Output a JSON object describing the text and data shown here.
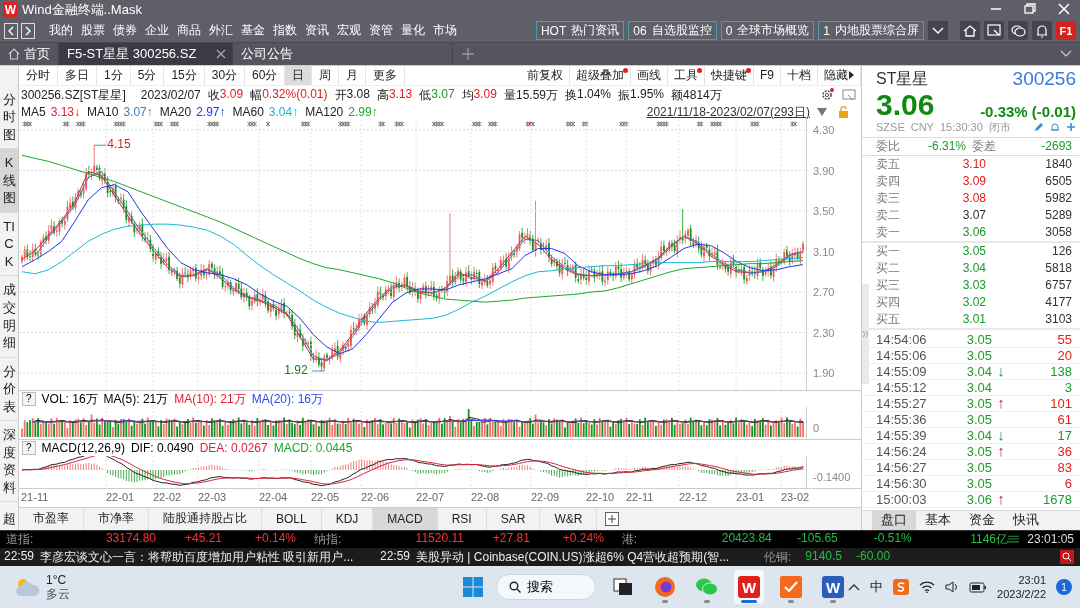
{
  "window": {
    "logo": "W",
    "title": "Wind金融终端..Mask"
  },
  "menu": [
    "我的",
    "股票",
    "债券",
    "企业",
    "商品",
    "外汇",
    "基金",
    "指数",
    "资讯",
    "宏观",
    "资管",
    "量化",
    "市场"
  ],
  "quick_links": [
    {
      "code": "HOT",
      "label": "热门资讯"
    },
    {
      "code": "06",
      "label": "自选股监控"
    },
    {
      "code": "0",
      "label": "全球市场概览"
    },
    {
      "code": "1",
      "label": "内地股票综合屏"
    }
  ],
  "help_badge": "F1",
  "tabs": [
    {
      "label": "首页",
      "kind": "home",
      "selected": false
    },
    {
      "label": "F5-ST星星 300256.SZ",
      "kind": "page",
      "selected": true
    },
    {
      "label": "公司公告",
      "kind": "page",
      "selected": false
    }
  ],
  "side_tabs": [
    {
      "label": "分时图",
      "selected": false
    },
    {
      "label": "K线图",
      "selected": true
    },
    {
      "label": "TICK",
      "selected": false
    },
    {
      "label": "成交明细",
      "selected": false
    },
    {
      "label": "分价表",
      "selected": false
    },
    {
      "label": "深度资料",
      "selected": false
    },
    {
      "label": "超",
      "selected": false
    }
  ],
  "periods": [
    {
      "label": "分时",
      "selected": false
    },
    {
      "label": "多日",
      "selected": false
    },
    {
      "label": "1分",
      "selected": false
    },
    {
      "label": "5分",
      "selected": false
    },
    {
      "label": "15分",
      "selected": false
    },
    {
      "label": "30分",
      "selected": false
    },
    {
      "label": "60分",
      "selected": false
    },
    {
      "label": "日",
      "selected": true
    },
    {
      "label": "周",
      "selected": false
    },
    {
      "label": "月",
      "selected": false
    },
    {
      "label": "更多",
      "selected": false
    }
  ],
  "tools": [
    {
      "label": "前复权",
      "dot": false
    },
    {
      "label": "超级叠加",
      "dot": true
    },
    {
      "label": "画线",
      "dot": false
    },
    {
      "label": "工具",
      "dot": true
    },
    {
      "label": "快捷键",
      "dot": true
    },
    {
      "label": "F9",
      "dot": false
    },
    {
      "label": "十档",
      "dot": false
    },
    {
      "label": "隐藏",
      "dot": false
    }
  ],
  "quote_line": {
    "symbol": "300256.SZ[ST星星]",
    "date": "2023/02/07",
    "fields": [
      {
        "label": "收",
        "value": "3.09",
        "color": "#e0201c"
      },
      {
        "label": "幅",
        "value": "0.32%(0.01)",
        "color": "#e0201c"
      },
      {
        "label": "开",
        "value": "3.08",
        "color": "#222222"
      },
      {
        "label": "高",
        "value": "3.13",
        "color": "#e0201c"
      },
      {
        "label": "低",
        "value": "3.07",
        "color": "#1a9a2a"
      },
      {
        "label": "均",
        "value": "3.09",
        "color": "#e0201c"
      },
      {
        "label": "量",
        "value": "15.59万",
        "color": "#222222"
      },
      {
        "label": "换",
        "value": "1.04%",
        "color": "#222222"
      },
      {
        "label": "振",
        "value": "1.95%",
        "color": "#222222"
      },
      {
        "label": "额",
        "value": "4814万",
        "color": "#222222"
      }
    ]
  },
  "ma_line": [
    "3.13↓",
    "3.07↑",
    "2.97↑",
    "3.04↑",
    "2.99↑"
  ],
  "date_range": "2021/11/18-2023/02/07(293日)",
  "price_chart": {
    "chart_data": {
      "type": "line",
      "ylim": [
        1.9,
        4.3
      ],
      "yticks": [
        {
          "value": 4.3,
          "label": "4.30"
        },
        {
          "value": 3.9,
          "label": "3.90"
        },
        {
          "value": 3.5,
          "label": "3.50"
        },
        {
          "value": 3.1,
          "label": "3.10"
        },
        {
          "value": 2.7,
          "label": "2.70"
        },
        {
          "value": 2.3,
          "label": "2.30"
        },
        {
          "value": 1.9,
          "label": "1.90"
        }
      ],
      "grid": true,
      "series": [
        {
          "name": "MA5",
          "color": "#e0203a",
          "values": [
            3.02,
            3.11,
            3.26,
            3.41,
            3.59,
            3.89,
            3.85,
            3.65,
            3.45,
            3.26,
            3.1,
            2.94,
            2.85,
            2.87,
            2.93,
            2.84,
            2.72,
            2.65,
            2.61,
            2.55,
            2.48,
            2.26,
            2.04,
            2.03,
            2.12,
            2.29,
            2.49,
            2.64,
            2.76,
            2.76,
            2.7,
            2.69,
            2.74,
            2.89,
            2.84,
            2.81,
            2.93,
            3.09,
            3.25,
            3.17,
            3.02,
            2.93,
            2.87,
            2.86,
            2.87,
            2.88,
            2.9,
            2.96,
            3.03,
            3.16,
            3.25,
            3.18,
            3.06,
            2.97,
            2.9,
            2.89,
            2.9,
            2.97,
            3.07,
            3.1
          ]
        },
        {
          "name": "MA10",
          "color": "#4a7ab8",
          "values": [
            null,
            3.06,
            3.24,
            3.39,
            3.56,
            3.83,
            3.89,
            3.68,
            3.49,
            3.3,
            3.13,
            2.97,
            2.86,
            2.86,
            2.92,
            2.87,
            2.74,
            2.66,
            2.62,
            2.57,
            2.49,
            2.31,
            2.07,
            2.02,
            2.1,
            2.26,
            2.46,
            2.62,
            2.74,
            2.77,
            2.71,
            2.69,
            2.73,
            2.86,
            2.87,
            2.8,
            2.9,
            3.06,
            3.22,
            3.21,
            3.05,
            2.95,
            2.88,
            2.86,
            2.87,
            2.88,
            2.9,
            2.95,
            3.02,
            3.14,
            3.25,
            3.2,
            3.08,
            2.99,
            2.92,
            2.89,
            2.9,
            2.95,
            3.06,
            3.1
          ]
        },
        {
          "name": "MA20",
          "color": "#1a3ae8",
          "values": [
            2.95,
            3.02,
            3.1,
            3.2,
            3.4,
            3.61,
            3.73,
            3.76,
            3.69,
            3.49,
            3.31,
            3.13,
            2.99,
            2.92,
            2.89,
            2.87,
            2.83,
            2.77,
            2.68,
            2.61,
            2.56,
            2.44,
            2.28,
            2.16,
            2.09,
            2.14,
            2.28,
            2.44,
            2.6,
            2.69,
            2.73,
            2.73,
            2.72,
            2.77,
            2.8,
            2.83,
            2.88,
            2.93,
            3.06,
            3.13,
            3.13,
            3.08,
            2.96,
            2.9,
            2.87,
            2.87,
            2.88,
            2.91,
            2.96,
            3.04,
            3.13,
            3.17,
            3.16,
            3.09,
            3.0,
            2.94,
            2.91,
            2.92,
            2.95,
            2.97
          ]
        },
        {
          "name": "MA60",
          "color": "#1ab8d8",
          "values": [
            2.9,
            2.88,
            2.92,
            3.0,
            3.1,
            3.2,
            3.27,
            3.32,
            3.35,
            3.36,
            3.37,
            3.37,
            3.36,
            3.34,
            3.31,
            3.25,
            3.17,
            3.06,
            2.96,
            2.87,
            2.79,
            2.71,
            2.62,
            2.55,
            2.49,
            2.45,
            2.41,
            2.4,
            2.41,
            2.42,
            2.43,
            2.44,
            2.47,
            2.53,
            2.6,
            2.66,
            2.73,
            2.8,
            2.86,
            2.9,
            2.91,
            2.93,
            2.94,
            2.95,
            2.96,
            2.96,
            2.97,
            2.98,
            2.99,
            2.99,
            2.99,
            2.99,
            3.0,
            3.0,
            3.0,
            3.0,
            3.01,
            3.02,
            3.03,
            3.04
          ]
        },
        {
          "name": "MA120",
          "color": "#1aa82a",
          "values": [
            4.05,
            4.02,
            3.99,
            3.95,
            3.91,
            3.87,
            3.83,
            3.79,
            3.74,
            3.69,
            3.64,
            3.59,
            3.54,
            3.49,
            3.44,
            3.39,
            3.33,
            3.27,
            3.21,
            3.15,
            3.09,
            3.03,
            2.98,
            2.94,
            2.92,
            2.89,
            2.86,
            2.83,
            2.79,
            2.74,
            2.69,
            2.66,
            2.63,
            2.62,
            2.61,
            2.6,
            2.61,
            2.62,
            2.64,
            2.65,
            2.66,
            2.67,
            2.68,
            2.7,
            2.71,
            2.74,
            2.78,
            2.82,
            2.86,
            2.9,
            2.93,
            2.94,
            2.95,
            2.96,
            2.97,
            2.98,
            2.98,
            2.99,
            3.0,
            3.01
          ]
        }
      ],
      "annotations": [
        "4.15",
        "1.92"
      ]
    }
  },
  "volume": {
    "help": "?",
    "legend": [
      {
        "text": "VOL: 16万",
        "color": "#000000"
      },
      {
        "text": "MA(5): 21万",
        "color": "#000000"
      },
      {
        "text": "MA(10): 21万",
        "color": "#e0203a"
      },
      {
        "text": "MA(20): 16万",
        "color": "#2a4ae8"
      }
    ],
    "axis_label": "0"
  },
  "macd": {
    "help": "?",
    "legend": [
      {
        "text": "MACD(12,26,9)",
        "color": "#000000"
      },
      {
        "text": "DIF: 0.0490",
        "color": "#000000"
      },
      {
        "text": "DEA: 0.0267",
        "color": "#e0203a"
      },
      {
        "text": "MACD: 0.0445",
        "color": "#1aa82a"
      }
    ],
    "axis_label": "-0.1400"
  },
  "x_labels": [
    "21-11",
    "22-01",
    "22-02",
    "22-03",
    "22-04",
    "22-05",
    "22-06",
    "22-07",
    "22-08",
    "22-09",
    "22-10",
    "22-11",
    "22-12",
    "23-01",
    "23-02"
  ],
  "indicator_tabs": [
    {
      "label": "市盈率",
      "selected": false
    },
    {
      "label": "市净率",
      "selected": false
    },
    {
      "label": "陆股通持股占比",
      "selected": false
    },
    {
      "label": "BOLL",
      "selected": false
    },
    {
      "label": "KDJ",
      "selected": false
    },
    {
      "label": "MACD",
      "selected": true
    },
    {
      "label": "RSI",
      "selected": false
    },
    {
      "label": "SAR",
      "selected": false
    },
    {
      "label": "W&R",
      "selected": false
    }
  ],
  "stock": {
    "name": "ST星星",
    "code": "300256",
    "price": "3.06",
    "change": "-0.33% (-0.01)",
    "exchange": "SZSE",
    "currency": "CNY",
    "time": "15:30:30",
    "status": "闭市"
  },
  "order_ratio": {
    "label": "委比",
    "value": "-6.31%",
    "diff_label": "委差",
    "diff": "-2693"
  },
  "asks": [
    {
      "label": "卖五",
      "price": "3.10",
      "volume": "1840",
      "color": "#e0201c"
    },
    {
      "label": "卖四",
      "price": "3.09",
      "volume": "6505",
      "color": "#e0201c"
    },
    {
      "label": "卖三",
      "price": "3.08",
      "volume": "5982",
      "color": "#e0201c"
    },
    {
      "label": "卖二",
      "price": "3.07",
      "volume": "5289",
      "color": "#333333"
    },
    {
      "label": "卖一",
      "price": "3.06",
      "volume": "3058",
      "color": "#1a9a2a"
    }
  ],
  "bids": [
    {
      "label": "买一",
      "price": "3.05",
      "volume": "126",
      "color": "#1a9a2a"
    },
    {
      "label": "买二",
      "price": "3.04",
      "volume": "5818",
      "color": "#1a9a2a"
    },
    {
      "label": "买三",
      "price": "3.03",
      "volume": "6757",
      "color": "#1a9a2a"
    },
    {
      "label": "买四",
      "price": "3.02",
      "volume": "4177",
      "color": "#1a9a2a"
    },
    {
      "label": "买五",
      "price": "3.01",
      "volume": "3103",
      "color": "#1a9a2a"
    }
  ],
  "ticks": [
    {
      "time": "14:54:06",
      "price": "3.05",
      "volume": "55",
      "color": "#e0201c"
    },
    {
      "time": "14:55:06",
      "price": "3.05",
      "volume": "20",
      "color": "#e0201c"
    },
    {
      "time": "14:55:09",
      "price": "3.04",
      "arrow": "↓",
      "rising": false,
      "volume": "138",
      "color": "#1a9a2a"
    },
    {
      "time": "14:55:12",
      "price": "3.04",
      "volume": "3",
      "color": "#1a9a2a"
    },
    {
      "time": "14:55:27",
      "price": "3.05",
      "arrow": "↑",
      "rising": true,
      "volume": "101",
      "color": "#e0201c"
    },
    {
      "time": "14:55:36",
      "price": "3.05",
      "volume": "61",
      "color": "#e0201c"
    },
    {
      "time": "14:55:39",
      "price": "3.04",
      "arrow": "↓",
      "rising": false,
      "volume": "17",
      "color": "#1a9a2a"
    },
    {
      "time": "14:56:24",
      "price": "3.05",
      "arrow": "↑",
      "rising": true,
      "volume": "36",
      "color": "#e0201c"
    },
    {
      "time": "14:56:27",
      "price": "3.05",
      "volume": "83",
      "color": "#e0201c"
    },
    {
      "time": "14:56:30",
      "price": "3.05",
      "volume": "6",
      "color": "#e0201c"
    },
    {
      "time": "15:00:03",
      "price": "3.06",
      "arrow": "↑",
      "rising": true,
      "volume": "1678",
      "color": "#1a9a2a"
    }
  ],
  "panel_tabs": [
    {
      "label": "盘口",
      "selected": true
    },
    {
      "label": "基本",
      "selected": false
    },
    {
      "label": "资金",
      "selected": false
    },
    {
      "label": "快讯",
      "selected": false
    }
  ],
  "indices": [
    {
      "name": "道指:",
      "value": "33174.80",
      "change": "+45.21",
      "pct": "+0.14%",
      "color": "#ff3030"
    },
    {
      "name": "纳指:",
      "value": "11520.11",
      "change": "+27.81",
      "pct": "+0.24%",
      "color": "#ff3030"
    },
    {
      "name": "港:",
      "value": "20423.84",
      "change": "-105.65",
      "pct": "-0.51%",
      "color": "#20c040"
    }
  ],
  "turnover": "1146亿",
  "clock": "23:01:05",
  "news": [
    {
      "time": "22:59",
      "text": "李彦宏谈文心一言：将帮助百度增加用户粘性 吸引新用户..."
    },
    {
      "time": "22:59",
      "text": "美股异动 | Coinbase(COIN.US)涨超6% Q4营收超预期(智..."
    }
  ],
  "commodity": {
    "name": "伦铜:",
    "value": "9140.5",
    "change": "-60.00",
    "color": "#20c040"
  },
  "taskbar": {
    "temperature": "1°C",
    "weather": "多云",
    "search": "搜索",
    "apps": [
      {
        "kind": "taskview",
        "active": false
      },
      {
        "kind": "firefox",
        "active": false
      },
      {
        "kind": "wechat",
        "active": false
      },
      {
        "kind": "wind",
        "glyph": "W",
        "active": true
      },
      {
        "kind": "check",
        "active": false
      },
      {
        "kind": "word",
        "glyph": "W",
        "active": false
      }
    ],
    "ime": "中",
    "time": "23:01",
    "date": "2023/2/22",
    "notifications": "1"
  }
}
